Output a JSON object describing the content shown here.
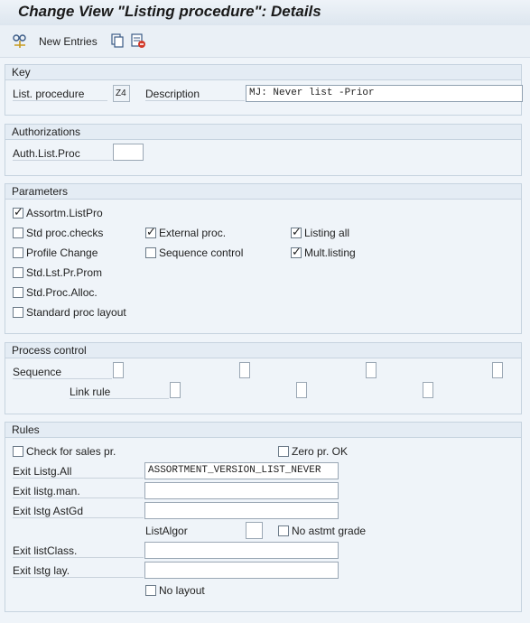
{
  "window": {
    "title": "Change View \"Listing procedure\": Details"
  },
  "toolbar": {
    "new_entries": "New Entries"
  },
  "key": {
    "header": "Key",
    "list_procedure_label": "List. procedure",
    "list_procedure_value": "Z4",
    "description_label": "Description",
    "description_value": "MJ: Never list -Prior"
  },
  "authorizations": {
    "header": "Authorizations",
    "auth_label": "Auth.List.Proc",
    "auth_value": ""
  },
  "parameters": {
    "header": "Parameters",
    "assortm_listpro": {
      "label": "Assortm.ListPro",
      "checked": true
    },
    "std_proc_checks": {
      "label": "Std proc.checks",
      "checked": false
    },
    "external_proc": {
      "label": "External proc.",
      "checked": true
    },
    "listing_all": {
      "label": "Listing all",
      "checked": true
    },
    "profile_change": {
      "label": "Profile Change",
      "checked": false
    },
    "sequence_control": {
      "label": "Sequence control",
      "checked": false
    },
    "mult_listing": {
      "label": "Mult.listing",
      "checked": true
    },
    "std_lst_pr_prom": {
      "label": "Std.Lst.Pr.Prom",
      "checked": false
    },
    "std_proc_alloc": {
      "label": "Std.Proc.Alloc.",
      "checked": false
    },
    "standard_proc_layout": {
      "label": "Standard proc layout",
      "checked": false
    }
  },
  "process_control": {
    "header": "Process control",
    "sequence_label": "Sequence",
    "link_rule_label": "Link rule"
  },
  "rules": {
    "header": "Rules",
    "check_sales_pr": {
      "label": "Check for sales pr.",
      "checked": false
    },
    "zero_pr_ok": {
      "label": "Zero pr. OK",
      "checked": false
    },
    "exit_listg_all_label": "Exit Listg.All",
    "exit_listg_all_value": "ASSORTMENT_VERSION_LIST_NEVER",
    "exit_listg_man_label": "Exit listg.man.",
    "exit_listg_man_value": "",
    "exit_lstg_astgd_label": "Exit lstg AstGd",
    "exit_lstg_astgd_value": "",
    "listalgor_label": "ListAlgor",
    "listalgor_value": "",
    "no_astmt_grade": {
      "label": "No astmt grade",
      "checked": false
    },
    "exit_listclass_label": "Exit listClass.",
    "exit_listclass_value": "",
    "exit_lstg_lay_label": "Exit lstg lay.",
    "exit_lstg_lay_value": "",
    "no_layout": {
      "label": "No layout",
      "checked": false
    }
  }
}
